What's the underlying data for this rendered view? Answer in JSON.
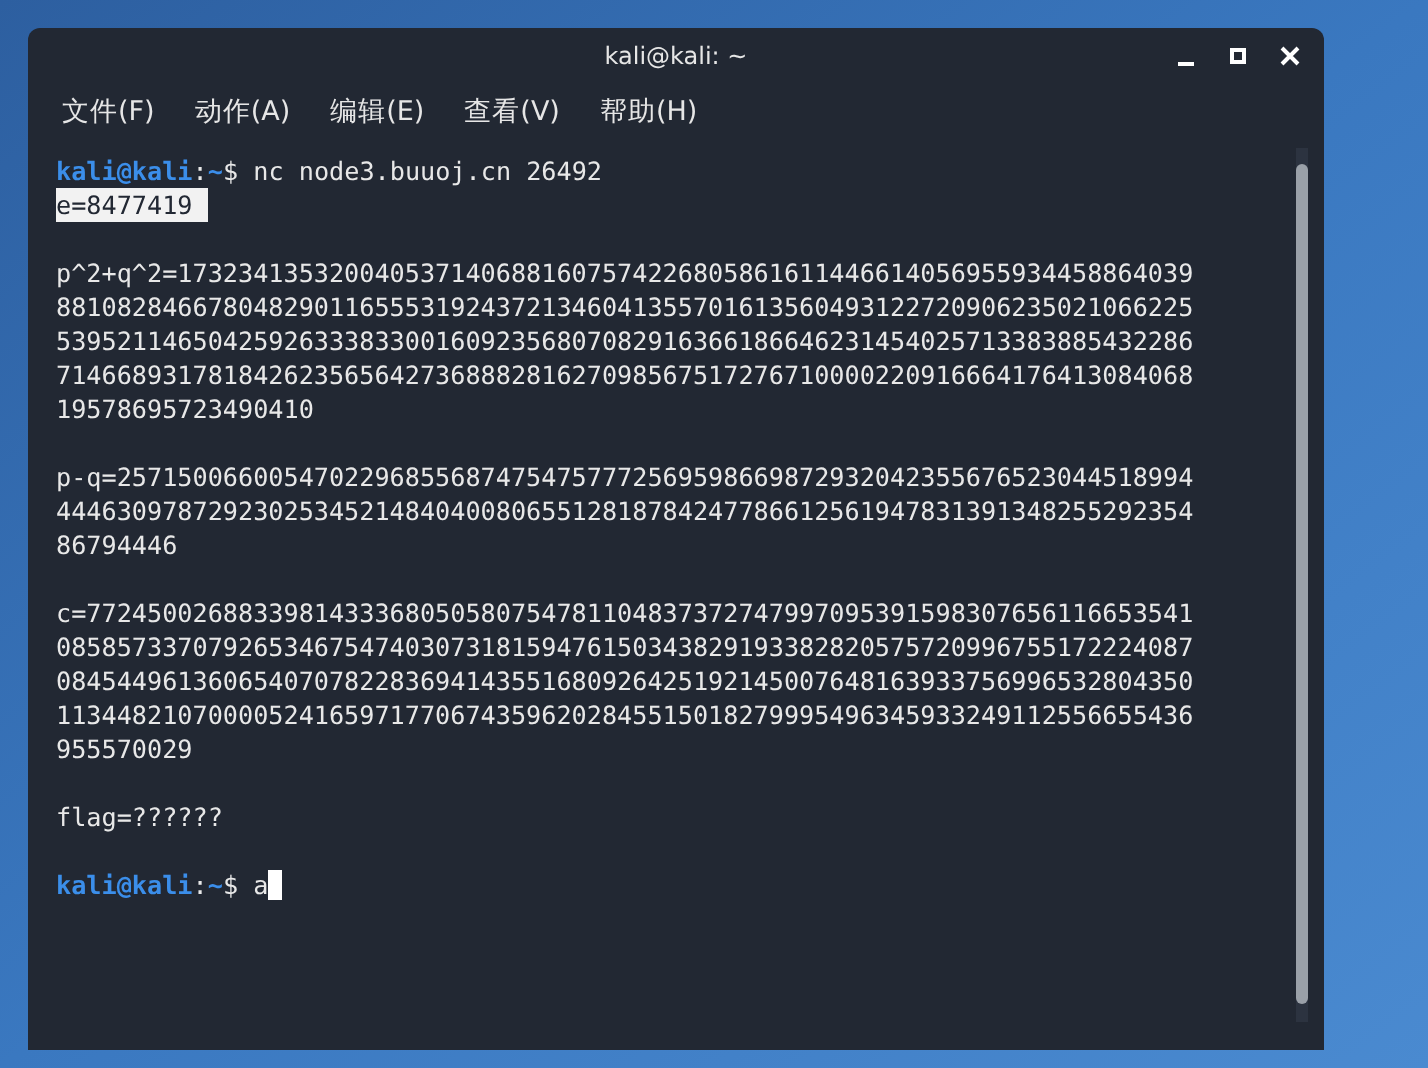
{
  "window": {
    "title": "kali@kali: ~"
  },
  "menu": [
    "文件(F)",
    "动作(A)",
    "编辑(E)",
    "查看(V)",
    "帮助(H)"
  ],
  "terminal": {
    "lines": [
      {
        "kind": "prompt",
        "user": "kali@kali",
        "sep": ":",
        "path": "~",
        "symbol": "$",
        "command": "nc node3.buuoj.cn 26492",
        "cursor": false
      },
      {
        "kind": "output",
        "text": "e=8477419",
        "selected": true
      },
      {
        "kind": "blank"
      },
      {
        "kind": "output",
        "text": "p^2+q^2=1732341353200405371406881607574226805861611446614056955934458864039",
        "selected": false
      },
      {
        "kind": "output",
        "text": "881082846678048290116555319243721346041355701613560493122720906235021066225",
        "selected": false
      },
      {
        "kind": "output",
        "text": "539521146504259263338330016092356807082916366186646231454025713383885432286",
        "selected": false
      },
      {
        "kind": "output",
        "text": "714668931781842623565642736888281627098567517276710000220916664176413084068",
        "selected": false
      },
      {
        "kind": "output",
        "text": "19578695723490410",
        "selected": false
      },
      {
        "kind": "blank"
      },
      {
        "kind": "output",
        "text": "p-q=25715006600547022968556874754757772569598669872932042355676523044518994",
        "selected": false
      },
      {
        "kind": "output",
        "text": "444630978729230253452148404008065512818784247786612561947831391348255292354",
        "selected": false
      },
      {
        "kind": "output",
        "text": "86794446",
        "selected": false
      },
      {
        "kind": "blank"
      },
      {
        "kind": "output",
        "text": "c=7724500268833981433368050580754781104837372747997095391598307656116653541",
        "selected": false
      },
      {
        "kind": "output",
        "text": "085857337079265346754740307318159476150343829193382820575720996755172224087",
        "selected": false
      },
      {
        "kind": "output",
        "text": "084544961360654070782283694143551680926425192145007648163933756996532804350",
        "selected": false
      },
      {
        "kind": "output",
        "text": "113448210700005241659717706743596202845515018279995496345933249112556655436",
        "selected": false
      },
      {
        "kind": "output",
        "text": "955570029",
        "selected": false
      },
      {
        "kind": "blank"
      },
      {
        "kind": "output",
        "text": "flag=??????",
        "selected": false
      },
      {
        "kind": "blank"
      },
      {
        "kind": "prompt",
        "user": "kali@kali",
        "sep": ":",
        "path": "~",
        "symbol": "$",
        "command": "a",
        "cursor": true
      }
    ]
  }
}
